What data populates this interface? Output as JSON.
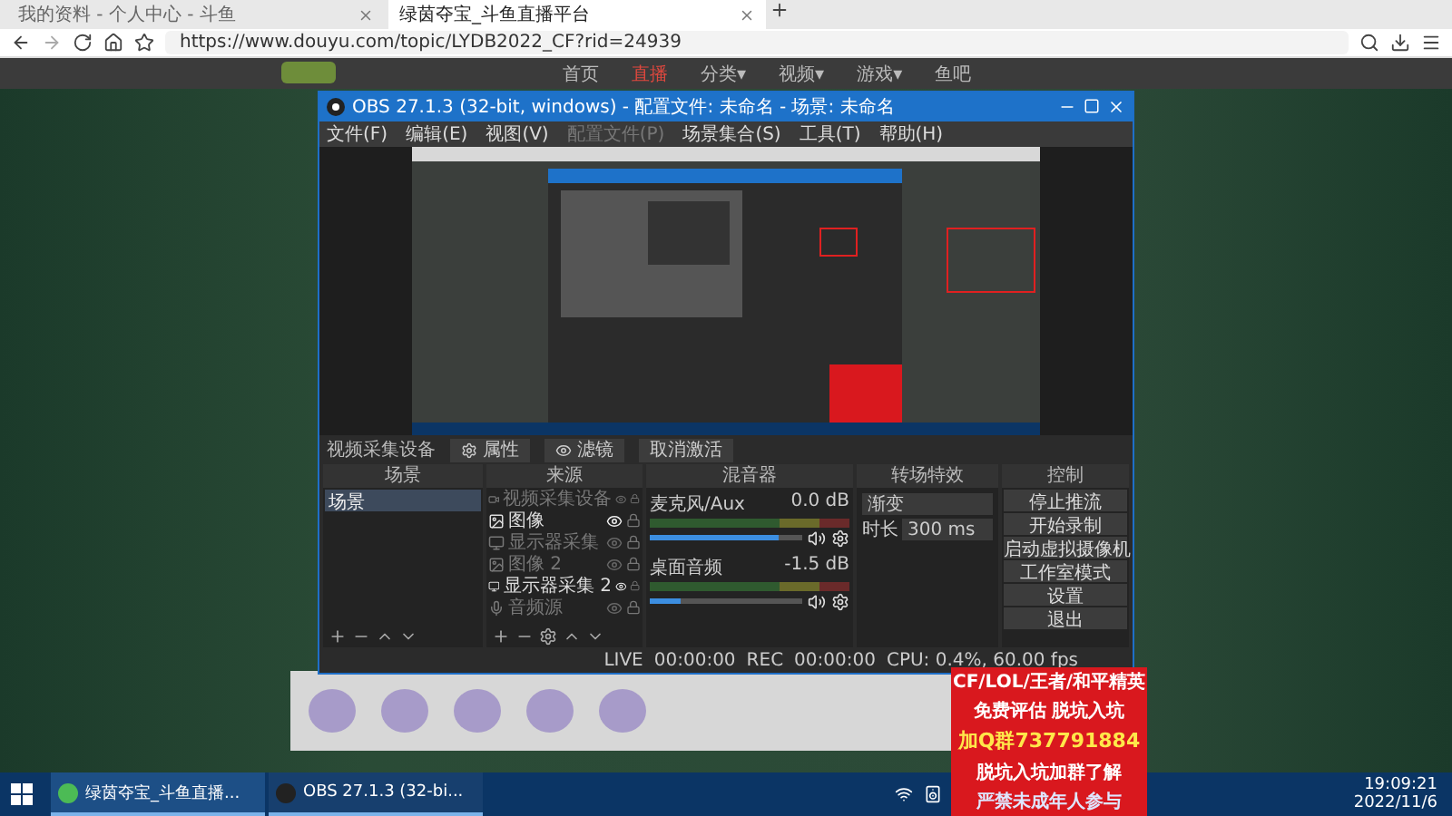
{
  "browser": {
    "tabs": [
      {
        "title": "我的资料 - 个人中心 - 斗鱼",
        "selected": false
      },
      {
        "title": "绿茵夺宝_斗鱼直播平台",
        "selected": true
      }
    ],
    "url": "https://www.douyu.com/topic/LYDB2022_CF?rid=24939"
  },
  "site_nav": [
    {
      "label": "首页",
      "selected": false
    },
    {
      "label": "直播",
      "selected": true
    },
    {
      "label": "分类▾",
      "selected": false
    },
    {
      "label": "视频▾",
      "selected": false
    },
    {
      "label": "游戏▾",
      "selected": false
    },
    {
      "label": "鱼吧",
      "selected": false
    }
  ],
  "obs": {
    "title": "OBS 27.1.3 (32-bit, windows) - 配置文件: 未命名 - 场景: 未命名",
    "menu": [
      {
        "label": "文件(F)",
        "disabled": false
      },
      {
        "label": "编辑(E)",
        "disabled": false
      },
      {
        "label": "视图(V)",
        "disabled": false
      },
      {
        "label": "配置文件(P)",
        "disabled": true
      },
      {
        "label": "场景集合(S)",
        "disabled": false
      },
      {
        "label": "工具(T)",
        "disabled": false
      },
      {
        "label": "帮助(H)",
        "disabled": false
      }
    ],
    "toolbar": {
      "source": "视频采集设备",
      "properties": "属性",
      "filters": "滤镜",
      "deactivate": "取消激活"
    },
    "scenes": {
      "title": "场景",
      "items": [
        {
          "name": "场景",
          "selected": true
        }
      ]
    },
    "sources": {
      "title": "来源",
      "items": [
        {
          "name": "视频采集设备",
          "kind": "camera",
          "visible": false
        },
        {
          "name": "图像",
          "kind": "image",
          "visible": true
        },
        {
          "name": "显示器采集",
          "kind": "monitor",
          "visible": false
        },
        {
          "name": "图像 2",
          "kind": "image",
          "visible": false
        },
        {
          "name": "显示器采集 2",
          "kind": "monitor",
          "visible": true
        },
        {
          "name": "音频源",
          "kind": "audio",
          "visible": false
        }
      ]
    },
    "mixer": {
      "title": "混音器",
      "channels": [
        {
          "name": "麦克风/Aux",
          "reading": "0.0 dB",
          "level": 0.85
        },
        {
          "name": "桌面音频",
          "reading": "-1.5 dB",
          "level": 0.2
        }
      ]
    },
    "transitions": {
      "title": "转场特效",
      "transition": "渐变",
      "duration_label": "时长",
      "duration": "300 ms"
    },
    "controls": {
      "title": "控制",
      "buttons": [
        "停止推流",
        "开始录制",
        "启动虚拟摄像机",
        "工作室模式",
        "设置",
        "退出"
      ]
    },
    "status": {
      "live_label": "LIVE",
      "live_time": "00:00:00",
      "rec_label": "REC",
      "rec_time": "00:00:00",
      "cpu": "CPU: 0.4%, 60.00 fps"
    }
  },
  "ad": {
    "lines": [
      "CF/LOL/王者/和平精英",
      "免费评估 脱坑入坑",
      "加Q群737791884",
      "脱坑入坑加群了解",
      "严禁未成年人参与"
    ]
  },
  "taskbar": {
    "apps": [
      {
        "label": "绿茵夺宝_斗鱼直播...",
        "kind": "browser"
      },
      {
        "label": "OBS 27.1.3 (32-bi...",
        "kind": "obs"
      }
    ],
    "time": "19:09:21",
    "date": "2022/11/6"
  }
}
